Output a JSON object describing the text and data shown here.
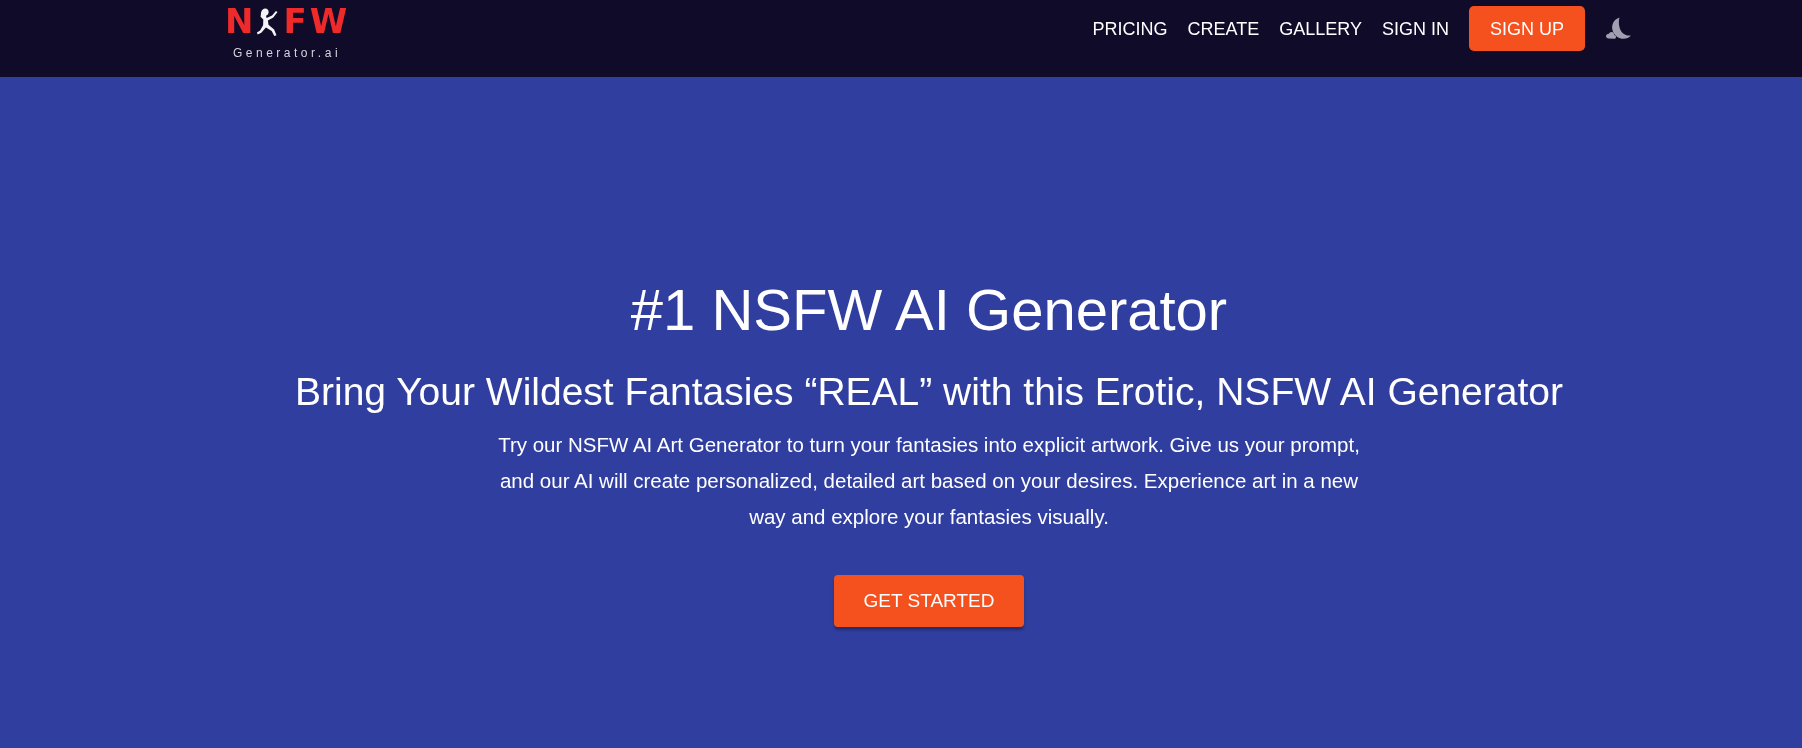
{
  "header": {
    "logo": {
      "text_before": "N",
      "text_after": "FW",
      "subtitle": "Generator.ai"
    },
    "nav": [
      {
        "label": "PRICING",
        "kind": "link"
      },
      {
        "label": "CREATE",
        "kind": "link"
      },
      {
        "label": "GALLERY",
        "kind": "link"
      },
      {
        "label": "SIGN IN",
        "kind": "link"
      },
      {
        "label": "SIGN UP",
        "kind": "button"
      }
    ]
  },
  "hero": {
    "title": "#1 NSFW AI Generator",
    "subtitle": "Bring Your Wildest Fantasies “REAL” with this Erotic, NSFW AI Generator",
    "description": "Try our NSFW AI Art Generator to turn your fantasies into explicit artwork. Give us your prompt, and our AI will create personalized, detailed art based on your desires. Experience art in a new way and explore your fantasies visually.",
    "button": "GET STARTED"
  }
}
